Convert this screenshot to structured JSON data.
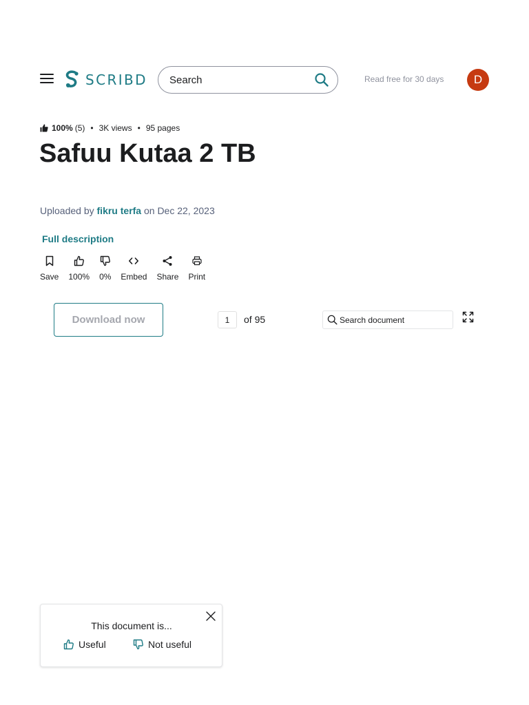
{
  "header": {
    "logo_text": "SCRIBD",
    "search_placeholder": "Search",
    "read_free": "Read free for 30 days",
    "avatar_initial": "D",
    "brand_color": "#1e7b85",
    "avatar_color": "#c63a11"
  },
  "meta": {
    "rating": "100%",
    "rating_count": "(5)",
    "views": "3K views",
    "pages": "95 pages"
  },
  "document": {
    "title": "Safuu Kutaa 2 TB",
    "uploaded_prefix": "Uploaded by",
    "author": "fikru terfa",
    "uploaded_on": "on Dec 22, 2023",
    "full_description": "Full description"
  },
  "actions": [
    {
      "label": "Save",
      "icon": "bookmark-icon"
    },
    {
      "label": "100%",
      "icon": "thumbs-up-icon"
    },
    {
      "label": "0%",
      "icon": "thumbs-down-icon"
    },
    {
      "label": "Embed",
      "icon": "code-icon"
    },
    {
      "label": "Share",
      "icon": "share-icon"
    },
    {
      "label": "Print",
      "icon": "print-icon"
    }
  ],
  "viewer": {
    "download_label": "Download now",
    "current_page": "1",
    "total_pages": "of 95",
    "search_placeholder": "Search document"
  },
  "feedback": {
    "question": "This document is...",
    "useful": "Useful",
    "not_useful": "Not useful"
  }
}
